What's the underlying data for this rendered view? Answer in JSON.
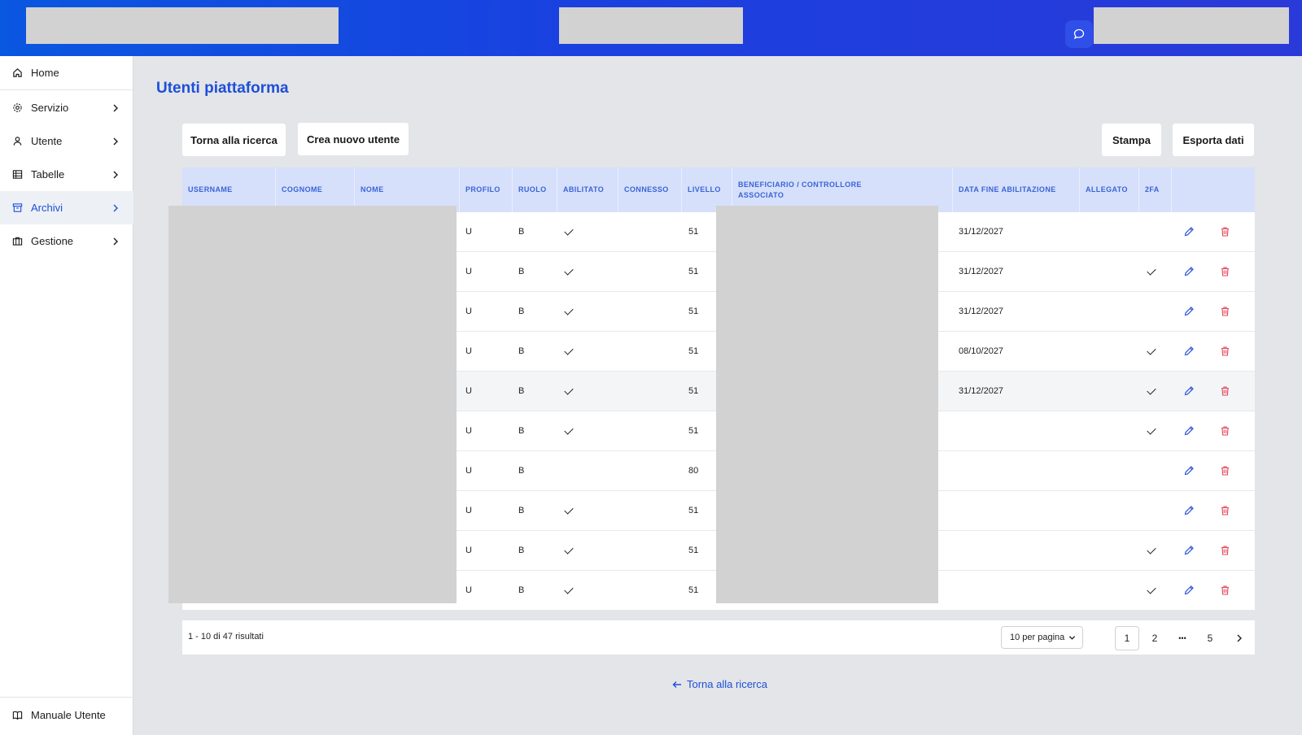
{
  "sidebar": {
    "items": [
      {
        "label": "Home",
        "icon": "home-icon"
      },
      {
        "label": "Servizio",
        "icon": "gear-icon"
      },
      {
        "label": "Utente",
        "icon": "user-icon"
      },
      {
        "label": "Tabelle",
        "icon": "table-icon"
      },
      {
        "label": "Archivi",
        "icon": "archive-icon"
      },
      {
        "label": "Gestione",
        "icon": "briefcase-icon"
      }
    ],
    "manual": {
      "label": "Manuale Utente",
      "icon": "book-icon"
    }
  },
  "page": {
    "title": "Utenti piattaforma"
  },
  "toolbar": {
    "back_label": "Torna alla ricerca",
    "new_user_label": "Crea nuovo utente",
    "print_label": "Stampa",
    "export_label": "Esporta dati"
  },
  "table": {
    "headers": {
      "username": "USERNAME",
      "cognome": "COGNOME",
      "nome": "NOME",
      "profilo": "PROFILO",
      "ruolo": "RUOLO",
      "abilitato": "ABILITATO",
      "connesso": "CONNESSO",
      "livello": "LIVELLO",
      "beneficiario": "BENEFICIARIO / CONTROLLORE ASSOCIATO",
      "data_fine": "DATA FINE ABILITAZIONE",
      "allegato": "ALLEGATO",
      "twofa": "2FA"
    },
    "rows": [
      {
        "profilo": "U",
        "ruolo": "B",
        "abilitato": true,
        "livello": "51",
        "data_fine": "31/12/2027",
        "twofa": false
      },
      {
        "profilo": "U",
        "ruolo": "B",
        "abilitato": true,
        "livello": "51",
        "data_fine": "31/12/2027",
        "twofa": true
      },
      {
        "profilo": "U",
        "ruolo": "B",
        "abilitato": true,
        "livello": "51",
        "data_fine": "31/12/2027",
        "twofa": false
      },
      {
        "profilo": "U",
        "ruolo": "B",
        "abilitato": true,
        "livello": "51",
        "data_fine": "08/10/2027",
        "twofa": true
      },
      {
        "profilo": "U",
        "ruolo": "B",
        "abilitato": true,
        "livello": "51",
        "data_fine": "31/12/2027",
        "twofa": true
      },
      {
        "profilo": "U",
        "ruolo": "B",
        "abilitato": true,
        "livello": "51",
        "data_fine": "",
        "twofa": true
      },
      {
        "profilo": "U",
        "ruolo": "B",
        "abilitato": false,
        "livello": "80",
        "data_fine": "",
        "twofa": false
      },
      {
        "profilo": "U",
        "ruolo": "B",
        "abilitato": true,
        "livello": "51",
        "data_fine": "",
        "twofa": false
      },
      {
        "profilo": "U",
        "ruolo": "B",
        "abilitato": true,
        "livello": "51",
        "data_fine": "",
        "twofa": true
      },
      {
        "profilo": "U",
        "ruolo": "B",
        "abilitato": true,
        "livello": "51",
        "data_fine": "",
        "twofa": true
      }
    ]
  },
  "pager": {
    "count_text": "1 - 10 di 47 risultati",
    "per_page": "10 per pagina",
    "pages": [
      "1",
      "2",
      "•••",
      "5"
    ],
    "current_page": "1"
  },
  "footer": {
    "back_link": "Torna alla ricerca"
  },
  "colors": {
    "accent": "#1f4fd8",
    "header_gradient_start": "#0a57e0",
    "header_gradient_end": "#2a3ad8",
    "delete": "#e0445a",
    "table_header_bg": "#d6e0fb"
  }
}
